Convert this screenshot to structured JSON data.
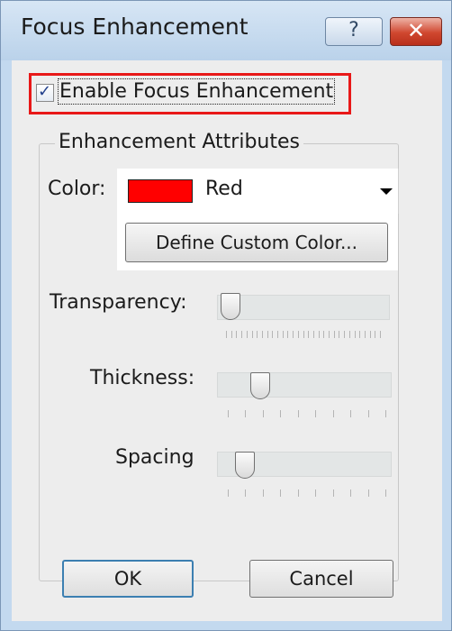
{
  "window": {
    "title": "Focus Enhancement",
    "help_glyph": "?",
    "close_glyph": "✕"
  },
  "enable": {
    "label": "Enable Focus Enhancement",
    "checked": true,
    "check_glyph": "✓",
    "highlight_color": "#e81818"
  },
  "group": {
    "title": "Enhancement Attributes"
  },
  "color": {
    "label": "Color:",
    "selected": "Red",
    "swatch": "#ff0000",
    "custom_button": "Define Custom Color..."
  },
  "sliders": {
    "transparency": {
      "label": "Transparency:",
      "value_fraction": 0.0,
      "tick_count": 31
    },
    "thickness": {
      "label": "Thickness:",
      "value_fraction": 0.2,
      "tick_count": 10
    },
    "spacing": {
      "label": "Spacing",
      "value_fraction": 0.1,
      "tick_count": 10
    }
  },
  "buttons": {
    "ok": "OK",
    "cancel": "Cancel"
  }
}
